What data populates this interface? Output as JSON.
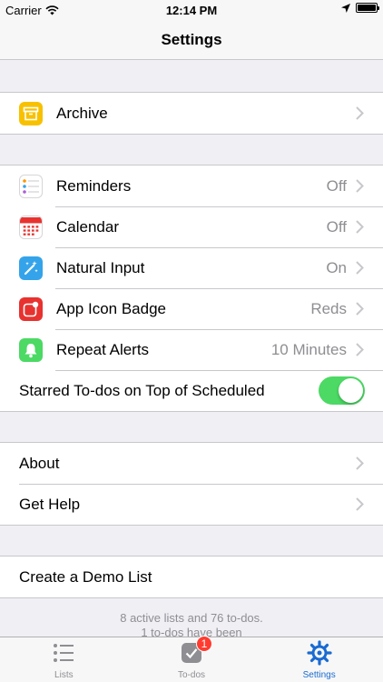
{
  "status": {
    "carrier": "Carrier",
    "time": "12:14 PM"
  },
  "nav": {
    "title": "Settings"
  },
  "archive": {
    "label": "Archive"
  },
  "integrations": {
    "reminders": {
      "label": "Reminders",
      "value": "Off"
    },
    "calendar": {
      "label": "Calendar",
      "value": "Off"
    },
    "natural_input": {
      "label": "Natural Input",
      "value": "On"
    },
    "app_icon_badge": {
      "label": "App Icon Badge",
      "value": "Reds"
    },
    "repeat_alerts": {
      "label": "Repeat Alerts",
      "value": "10 Minutes"
    },
    "starred_top": {
      "label": "Starred To-dos on Top of Scheduled",
      "enabled": true
    }
  },
  "help": {
    "about": "About",
    "get_help": "Get Help"
  },
  "demo": {
    "label": "Create a Demo List"
  },
  "footer": {
    "line1": "8 active lists and 76 to-dos.",
    "line2": "1 to-dos have been"
  },
  "tabs": {
    "lists": "Lists",
    "todos": "To-dos",
    "todos_badge": "1",
    "settings": "Settings"
  },
  "colors": {
    "accent": "#1a6bd1",
    "toggle_on": "#4cd964",
    "archive_icon": "#f7c100",
    "calendar_icon": "#e8322f",
    "natural_input_icon": "#34a3ea",
    "badge_icon": "#e8322f",
    "repeat_icon": "#4cd964"
  }
}
